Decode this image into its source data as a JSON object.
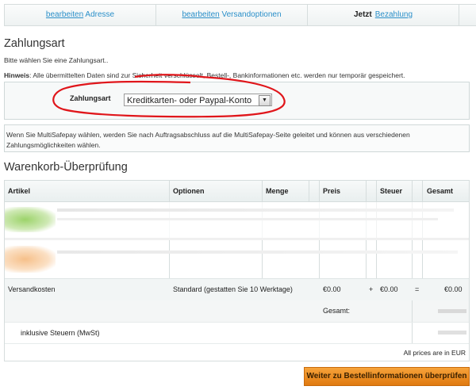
{
  "steps": [
    {
      "link": "bearbeiten",
      "label": "Adresse"
    },
    {
      "link": "bearbeiten",
      "label": "Versandoptionen"
    },
    {
      "prefix": "Jetzt",
      "label": "Bezahlung"
    }
  ],
  "payment": {
    "heading": "Zahlungsart",
    "intro": "Bitte wählen Sie eine Zahlungsart..",
    "hint_label": "Hinweis",
    "hint_text": ": Alle übermittelten Daten sind zur Sicherheit verschlüsselt, Bestell-, Bankinformationen etc. werden nur temporär gespeichert.",
    "method_label": "Zahlungsart",
    "method_value": "Kreditkarten- oder Paypal-Konto",
    "multisafepay_note": "Wenn Sie MultiSafepay wählen, werden Sie nach Auftragsabschluss auf die MultiSafepay-Seite geleitet und können aus verschiedenen Zahlungsmöglichkeiten wählen."
  },
  "cart": {
    "heading": "Warenkorb-Überprüfung",
    "columns": [
      "Artikel",
      "Optionen",
      "Menge",
      "Preis",
      "Steuer",
      "Gesamt"
    ],
    "shipping_row": {
      "label": "Versandkosten",
      "option": "Standard (gestatten Sie 10 Werktage)",
      "price": "€0.00",
      "plus": "+",
      "tax": "€0.00",
      "equals": "=",
      "total": "€0.00"
    },
    "total_label": "Gesamt:",
    "tax_note": "inklusive Steuern (MwSt)",
    "currency_note": "All prices are in EUR"
  },
  "submit_label": "Weiter zu Bestellinformationen überprüfen",
  "colors": {
    "accent": "#2a8fc9",
    "annotation": "#e0161b",
    "button": "#ee8a1e"
  }
}
